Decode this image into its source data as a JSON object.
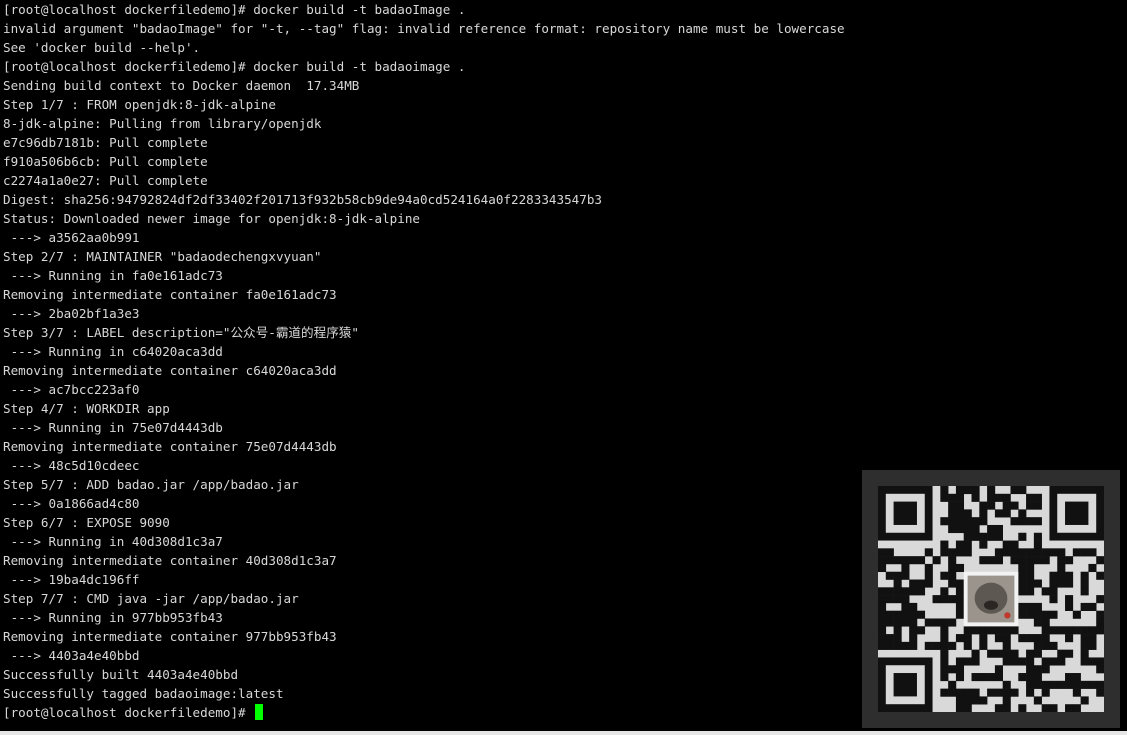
{
  "terminal": {
    "lines": [
      "[root@localhost dockerfiledemo]# docker build -t badaoImage .",
      "invalid argument \"badaoImage\" for \"-t, --tag\" flag: invalid reference format: repository name must be lowercase",
      "See 'docker build --help'.",
      "[root@localhost dockerfiledemo]# docker build -t badaoimage .",
      "Sending build context to Docker daemon  17.34MB",
      "Step 1/7 : FROM openjdk:8-jdk-alpine",
      "8-jdk-alpine: Pulling from library/openjdk",
      "e7c96db7181b: Pull complete",
      "f910a506b6cb: Pull complete",
      "c2274a1a0e27: Pull complete",
      "Digest: sha256:94792824df2df33402f201713f932b58cb9de94a0cd524164a0f2283343547b3",
      "Status: Downloaded newer image for openjdk:8-jdk-alpine",
      " ---> a3562aa0b991",
      "Step 2/7 : MAINTAINER \"badaodechengxvyuan\"",
      " ---> Running in fa0e161adc73",
      "Removing intermediate container fa0e161adc73",
      " ---> 2ba02bf1a3e3",
      "Step 3/7 : LABEL description=\"公众号-霸道的程序猿\"",
      " ---> Running in c64020aca3dd",
      "Removing intermediate container c64020aca3dd",
      " ---> ac7bcc223af0",
      "Step 4/7 : WORKDIR app",
      " ---> Running in 75e07d4443db",
      "Removing intermediate container 75e07d4443db",
      " ---> 48c5d10cdeec",
      "Step 5/7 : ADD badao.jar /app/badao.jar",
      " ---> 0a1866ad4c80",
      "Step 6/7 : EXPOSE 9090",
      " ---> Running in 40d308d1c3a7",
      "Removing intermediate container 40d308d1c3a7",
      " ---> 19ba4dc196ff",
      "Step 7/7 : CMD java -jar /app/badao.jar",
      " ---> Running in 977bb953fb43",
      "Removing intermediate container 977bb953fb43",
      " ---> 4403a4e40bbd",
      "Successfully built 4403a4e40bbd",
      "Successfully tagged badaoimage:latest"
    ],
    "prompt": "[root@localhost dockerfiledemo]# ",
    "text_color": "#d8d8d8",
    "background": "#000000",
    "cursor_color": "#00ff00"
  },
  "overlay": {
    "icon": "qr-code-icon",
    "avatar_icon": "dog-avatar-icon"
  }
}
